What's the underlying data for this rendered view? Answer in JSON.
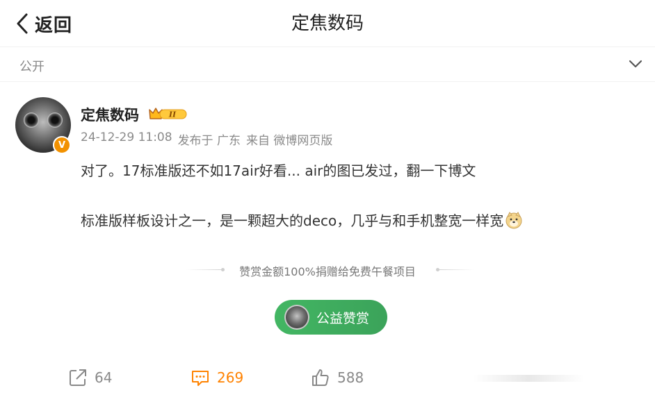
{
  "header": {
    "back_label": "返回",
    "title": "定焦数码"
  },
  "visibility": {
    "label": "公开"
  },
  "post": {
    "author": "定焦数码",
    "verified_mark": "V",
    "vip_level": "II",
    "date": "24-12-29 11:08",
    "location": "发布于 广东",
    "source": "来自 微博网页版",
    "line1": "对了。17标准版还不如17air好看... air的图已发过，翻一下博文",
    "line2": "标准版样板设计之一，是一颗超大的deco，几乎与和手机整宽一样宽"
  },
  "reward": {
    "note": "赞赏金额100%捐赠给免费午餐项目",
    "button_label": "公益赞赏",
    "button_color": "#3fae5f"
  },
  "actions": {
    "repost_count": "64",
    "comment_count": "269",
    "like_count": "588",
    "comment_color": "#ff8200"
  },
  "icons": [
    "chevron-left-icon",
    "chevron-down-icon",
    "vip-crown-icon",
    "doge-emoji-icon",
    "repost-icon",
    "comment-icon",
    "like-icon"
  ]
}
